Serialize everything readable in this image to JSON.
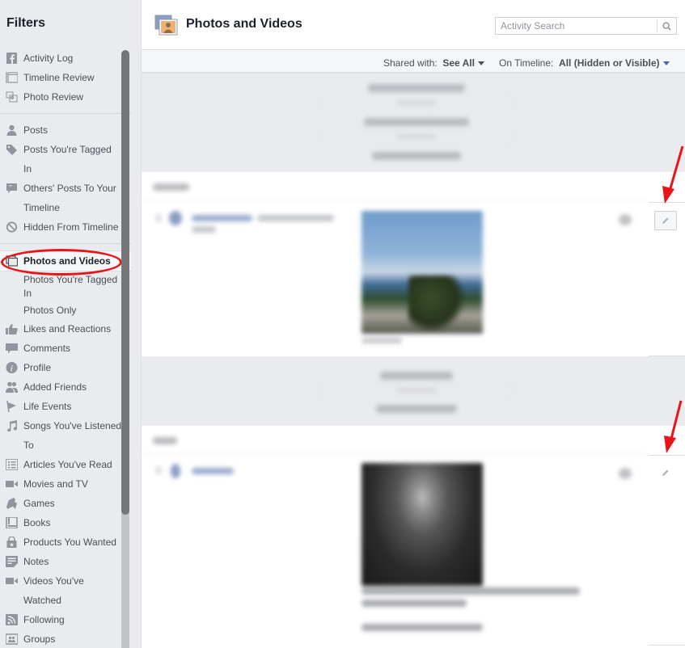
{
  "sidebar": {
    "title": "Filters",
    "groups": [
      [
        {
          "label": "Activity Log",
          "icon": "facebook-icon"
        },
        {
          "label": "Timeline Review",
          "icon": "timeline-review-icon"
        },
        {
          "label": "Photo Review",
          "icon": "photo-review-icon"
        }
      ],
      [
        {
          "label": "Posts",
          "icon": "person-icon"
        },
        {
          "label": "Posts You're Tagged In",
          "line1": "Posts You're Tagged",
          "line2": "In",
          "icon": "tag-icon"
        },
        {
          "label": "Others' Posts To Your Timeline",
          "line1": "Others' Posts To Your",
          "line2": "Timeline",
          "icon": "quote-bubble-icon"
        },
        {
          "label": "Hidden From Timeline",
          "icon": "hidden-icon"
        }
      ],
      [
        {
          "label": "Photos and Videos",
          "icon": "photos-icon",
          "selected": true
        },
        {
          "label": "Photos You're Tagged In",
          "line1": "Photos You're Tagged",
          "line2": "In",
          "sub": true
        },
        {
          "label": "Photos Only",
          "sub": true
        },
        {
          "label": "Likes and Reactions",
          "icon": "thumbs-up-icon"
        },
        {
          "label": "Comments",
          "icon": "comment-icon"
        },
        {
          "label": "Profile",
          "icon": "info-icon"
        },
        {
          "label": "Added Friends",
          "icon": "friends-icon"
        },
        {
          "label": "Life Events",
          "icon": "flag-icon"
        },
        {
          "label": "Songs You've Listened To",
          "line1": "Songs You've Listened",
          "line2": "To",
          "icon": "music-note-icon"
        },
        {
          "label": "Articles You've Read",
          "icon": "article-icon"
        },
        {
          "label": "Movies and TV",
          "icon": "video-camera-icon"
        },
        {
          "label": "Games",
          "icon": "gamepad-icon"
        },
        {
          "label": "Books",
          "icon": "book-icon"
        },
        {
          "label": "Products You Wanted",
          "icon": "shopping-bag-icon"
        },
        {
          "label": "Notes",
          "icon": "notes-icon"
        },
        {
          "label": "Videos You've Watched",
          "line1": "Videos You've",
          "line2": "Watched",
          "icon": "video-camera-icon"
        },
        {
          "label": "Following",
          "icon": "rss-icon"
        },
        {
          "label": "Groups",
          "icon": "groups-icon"
        }
      ]
    ],
    "scroll_position": 0.0,
    "annotation": {
      "type": "red-ellipse",
      "target": "Photos and Videos"
    }
  },
  "header": {
    "title": "Photos and Videos",
    "icon": "photos-and-videos-icon",
    "search": {
      "placeholder": "Activity Search",
      "value": ""
    }
  },
  "filters": {
    "shared_with_label": "Shared with:",
    "shared_with_value": "See All",
    "on_timeline_label": "On Timeline:",
    "on_timeline_value": "All (Hidden or Visible)"
  },
  "timeline": {
    "content_blurred": true,
    "cards": [
      {
        "photo": "blurred-landscape-photo",
        "edit_icon": "pencil-icon",
        "annotation": "red-arrow"
      },
      {
        "photo": "blurred-portrait-photo",
        "edit_icon": "pencil-icon",
        "annotation": "red-arrow"
      }
    ]
  },
  "colors": {
    "annotation_red": "#e8141a",
    "link_blue": "#4267b2",
    "sidebar_bg": "#e9ebee"
  }
}
